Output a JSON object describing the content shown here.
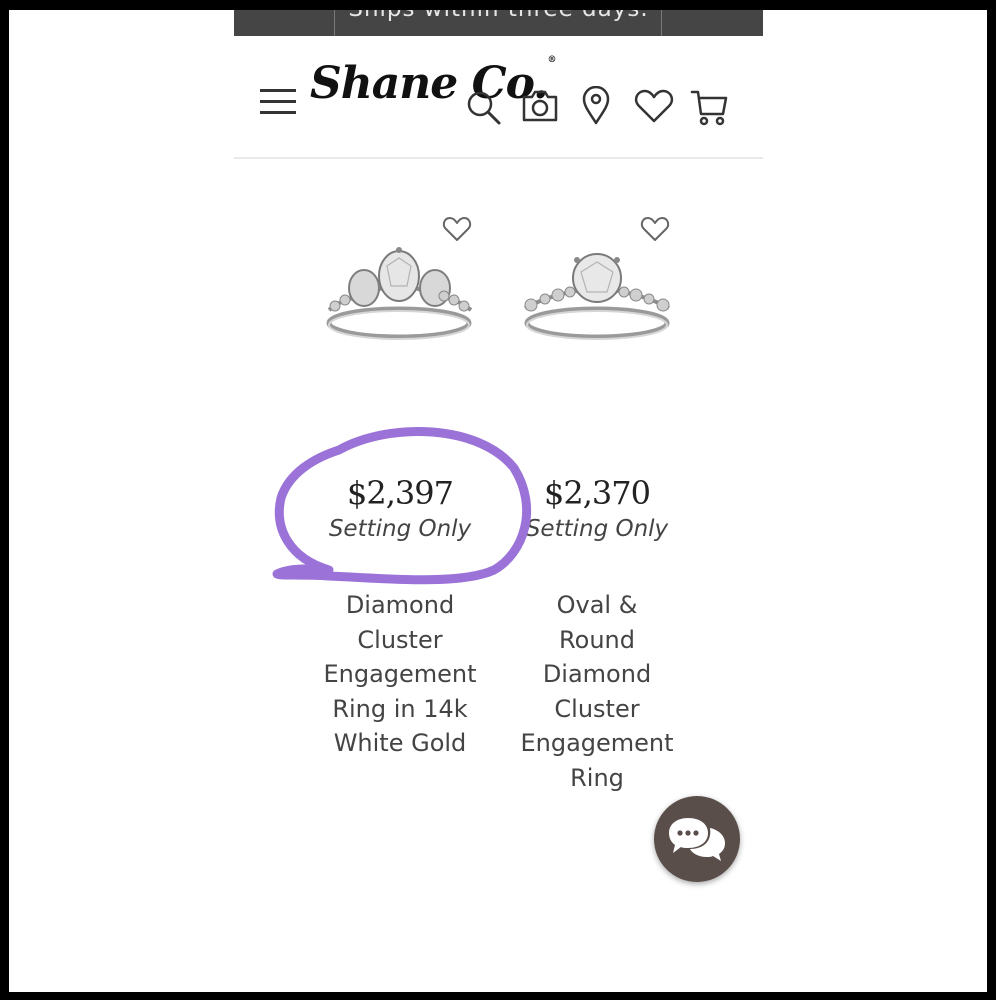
{
  "promo": {
    "text": "Ships within three days."
  },
  "header": {
    "logo_text": "Shane Co.",
    "logo_mark": "®",
    "icons": [
      "menu-icon",
      "search-icon",
      "camera-icon",
      "location-pin-icon",
      "heart-icon",
      "cart-icon"
    ]
  },
  "products": [
    {
      "price": "$2,397",
      "setting": "Setting Only",
      "name": "Diamond\nCluster\nEngagement\nRing in 14k\nWhite Gold"
    },
    {
      "price": "$2,370",
      "setting": "Setting Only",
      "name": "Oval &\nRound\nDiamond\nCluster\nEngagement\nRing"
    }
  ],
  "colors": {
    "promo_bg": "#454545",
    "annotation": "#9b73d8",
    "chat_bg": "#5a4e4b"
  }
}
